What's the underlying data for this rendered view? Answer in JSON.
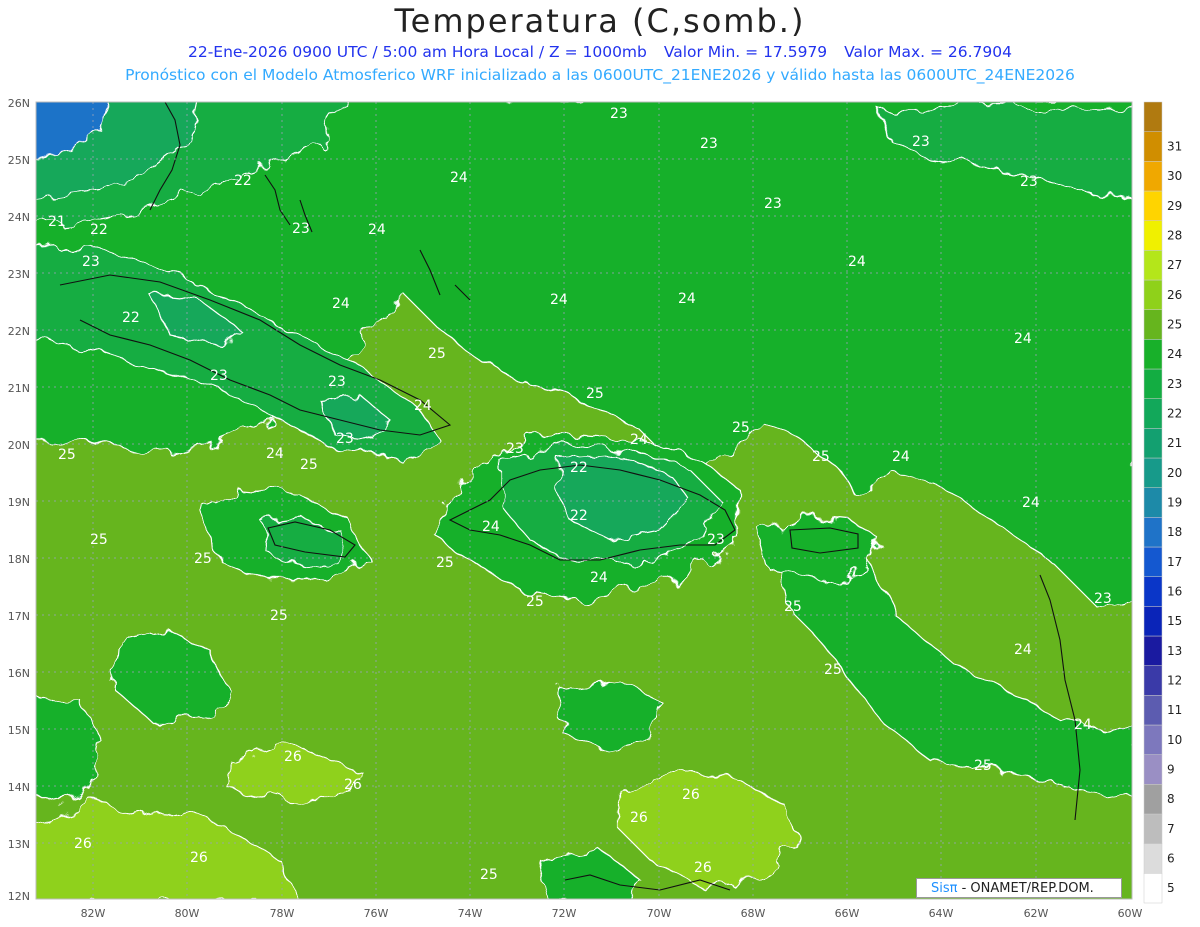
{
  "title": "Temperatura (C,somb.)",
  "subtitle": {
    "date_time": "22-Ene-2026  0900 UTC / 5:00 am Hora Local / Z = 1000mb",
    "min": "Valor Min. = 17.5979",
    "max": "Valor Max. = 26.7904"
  },
  "subtitle2": "Pronóstico con el Modelo Atmosferico WRF inicializado a las 0600UTC_21ENE2026 y válido hasta las  0600UTC_24ENE2026",
  "credit": {
    "brand": "Sisπ",
    "text": " - ONAMET/REP.DOM."
  },
  "lat_labels": [
    "26N",
    "25N",
    "24N",
    "23N",
    "22N",
    "21N",
    "20N",
    "19N",
    "18N",
    "17N",
    "16N",
    "15N",
    "14N",
    "13N",
    "12N"
  ],
  "lon_labels": [
    "82W",
    "80W",
    "78W",
    "76W",
    "74W",
    "72W",
    "70W",
    "68W",
    "66W",
    "64W",
    "62W",
    "60W"
  ],
  "colorbar": [
    {
      "label": "5",
      "color": "#ffffff"
    },
    {
      "label": "6",
      "color": "#dcdcdc"
    },
    {
      "label": "7",
      "color": "#bdbdbd"
    },
    {
      "label": "8",
      "color": "#a0a0a0"
    },
    {
      "label": "9",
      "color": "#9a8fc4"
    },
    {
      "label": "10",
      "color": "#7d78bd"
    },
    {
      "label": "11",
      "color": "#5c5cb0"
    },
    {
      "label": "12",
      "color": "#3a3aa8"
    },
    {
      "label": "13",
      "color": "#1a1aa0"
    },
    {
      "label": "15",
      "color": "#0a24b8"
    },
    {
      "label": "16",
      "color": "#0a36c8"
    },
    {
      "label": "17",
      "color": "#1458d0"
    },
    {
      "label": "18",
      "color": "#1f73c8"
    },
    {
      "label": "19",
      "color": "#1d8aa8"
    },
    {
      "label": "20",
      "color": "#179a8a"
    },
    {
      "label": "21",
      "color": "#13a070"
    },
    {
      "label": "22",
      "color": "#12a85a"
    },
    {
      "label": "23",
      "color": "#13ad42"
    },
    {
      "label": "24",
      "color": "#18b02a"
    },
    {
      "label": "25",
      "color": "#66b51e"
    },
    {
      "label": "26",
      "color": "#8fd11a"
    },
    {
      "label": "27",
      "color": "#b4e61a"
    },
    {
      "label": "28",
      "color": "#f0f000"
    },
    {
      "label": "29",
      "color": "#ffd400"
    },
    {
      "label": "30",
      "color": "#f0a800"
    },
    {
      "label": "31",
      "color": "#d08e00"
    },
    {
      "label": "",
      "color": "#b07a10"
    }
  ],
  "contour_labels": [
    "21",
    "22",
    "23",
    "24",
    "25",
    "26"
  ]
}
